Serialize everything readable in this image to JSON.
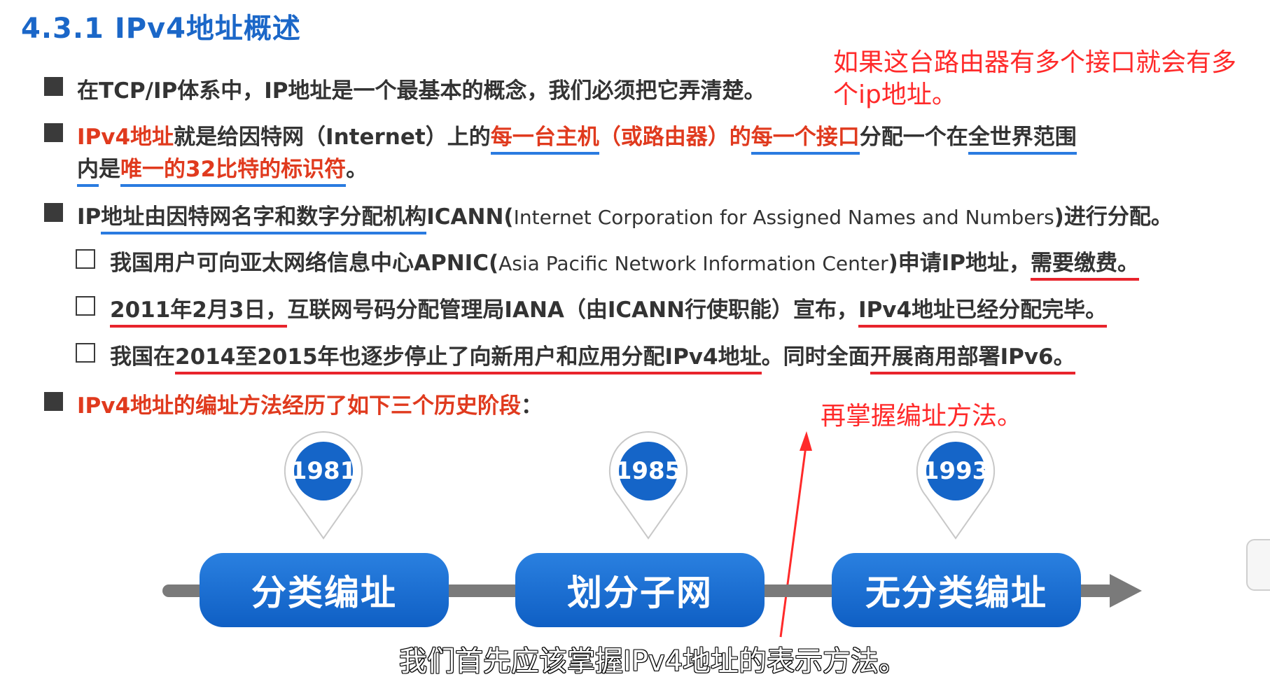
{
  "title": "4.3.1 IPv4地址概述",
  "notes": {
    "top_right_line1": "如果这台路由器有多个接口就会有多",
    "top_right_line2": "个ip地址。",
    "middle": "再掌握编址方法。"
  },
  "bullets": {
    "b1": "在TCP/IP体系中，IP地址是一个最基本的概念，我们必须把它弄清楚。",
    "b2_part1": "IPv4地址",
    "b2_part2": "就是给因特网（Internet）上的",
    "b2_part3": "每一台主机",
    "b2_part4": "（或路由器）",
    "b2_part5": "的",
    "b2_part6": "每一个接口",
    "b2_part7": "分配一个在",
    "b2_part8": "全世界范围",
    "b2_line2_part1": "内",
    "b2_line2_part2": "是",
    "b2_line2_part3": "唯一的",
    "b2_line2_part4": "32比特的标识符",
    "b2_line2_part5": "。",
    "b3_part1": "IP",
    "b3_part2": "地址由因特网名字和数字分配机构",
    "b3_part3": "ICANN(",
    "b3_part4": "Internet Corporation for Assigned Names and Numbers",
    "b3_part5": ")进行分配。",
    "s1_part1": "我国用户可向亚太网络信息中心APNIC(",
    "s1_part2": "Asia Pacific Network Information Center",
    "s1_part3": ")申请IP地址，",
    "s1_part4": "需要缴费。",
    "s2_part1": "2011年2月3日，",
    "s2_part2": "互联网号码分配管理局IANA（由ICANN行使职能）宣布，",
    "s2_part3": "IPv4地址已经分配完毕。",
    "s3_part1": "我国在",
    "s3_part2": "2014至2015年也逐步停止了向新用户和应用分配IPv4地址",
    "s3_part3": "。同时全面",
    "s3_part4": "开展商用部署IPv6。",
    "b4": "IPv4地址的编址方法经历了如下三个历史阶段",
    "b4_colon": "："
  },
  "timeline": [
    {
      "year": "1981",
      "label": "分类编址"
    },
    {
      "year": "1985",
      "label": "划分子网"
    },
    {
      "year": "1993",
      "label": "无分类编址"
    }
  ],
  "subtitle": "我们首先应该掌握IPv4地址的表示方法。",
  "colors": {
    "accent_blue": "#1b67c8",
    "accent_red": "#e03a1e",
    "annotation_red": "#ff2a2a"
  }
}
